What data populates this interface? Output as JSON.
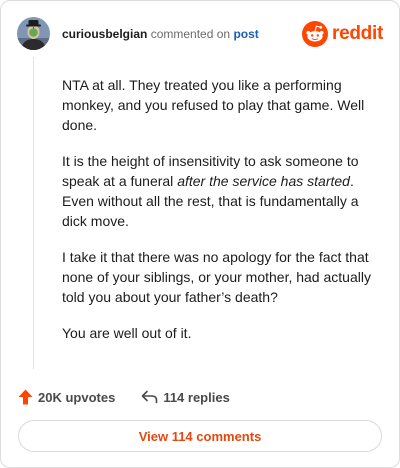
{
  "comment": {
    "username": "curiousbelgian",
    "action_text": "commented on",
    "post_link_label": "post",
    "paragraphs": [
      [
        "NTA at all. They treated you like a performing monkey, and you refused to play that game. Well done."
      ],
      [
        "It is the height of insensitivity to ask someone to speak at a funeral ",
        "after the service has started",
        ". Even without all the rest, that is fundamentally a dick move."
      ],
      [
        "I take it that there was no apology for the fact that none of your siblings, or your mother, had actually told you about your father’s death?"
      ],
      [
        "You are well out of it."
      ]
    ]
  },
  "brand": {
    "wordmark": "reddit",
    "color": "#ff4500",
    "icon": "reddit-alien-icon"
  },
  "stats": {
    "upvotes_label": "20K upvotes",
    "replies_label": "114 replies",
    "upvote_icon": "upvote-arrow-icon",
    "reply_icon": "reply-arrow-icon",
    "upvote_color": "#ff4500"
  },
  "actions": {
    "view_comments_label": "View 114 comments",
    "accent_color": "#e5480f"
  }
}
